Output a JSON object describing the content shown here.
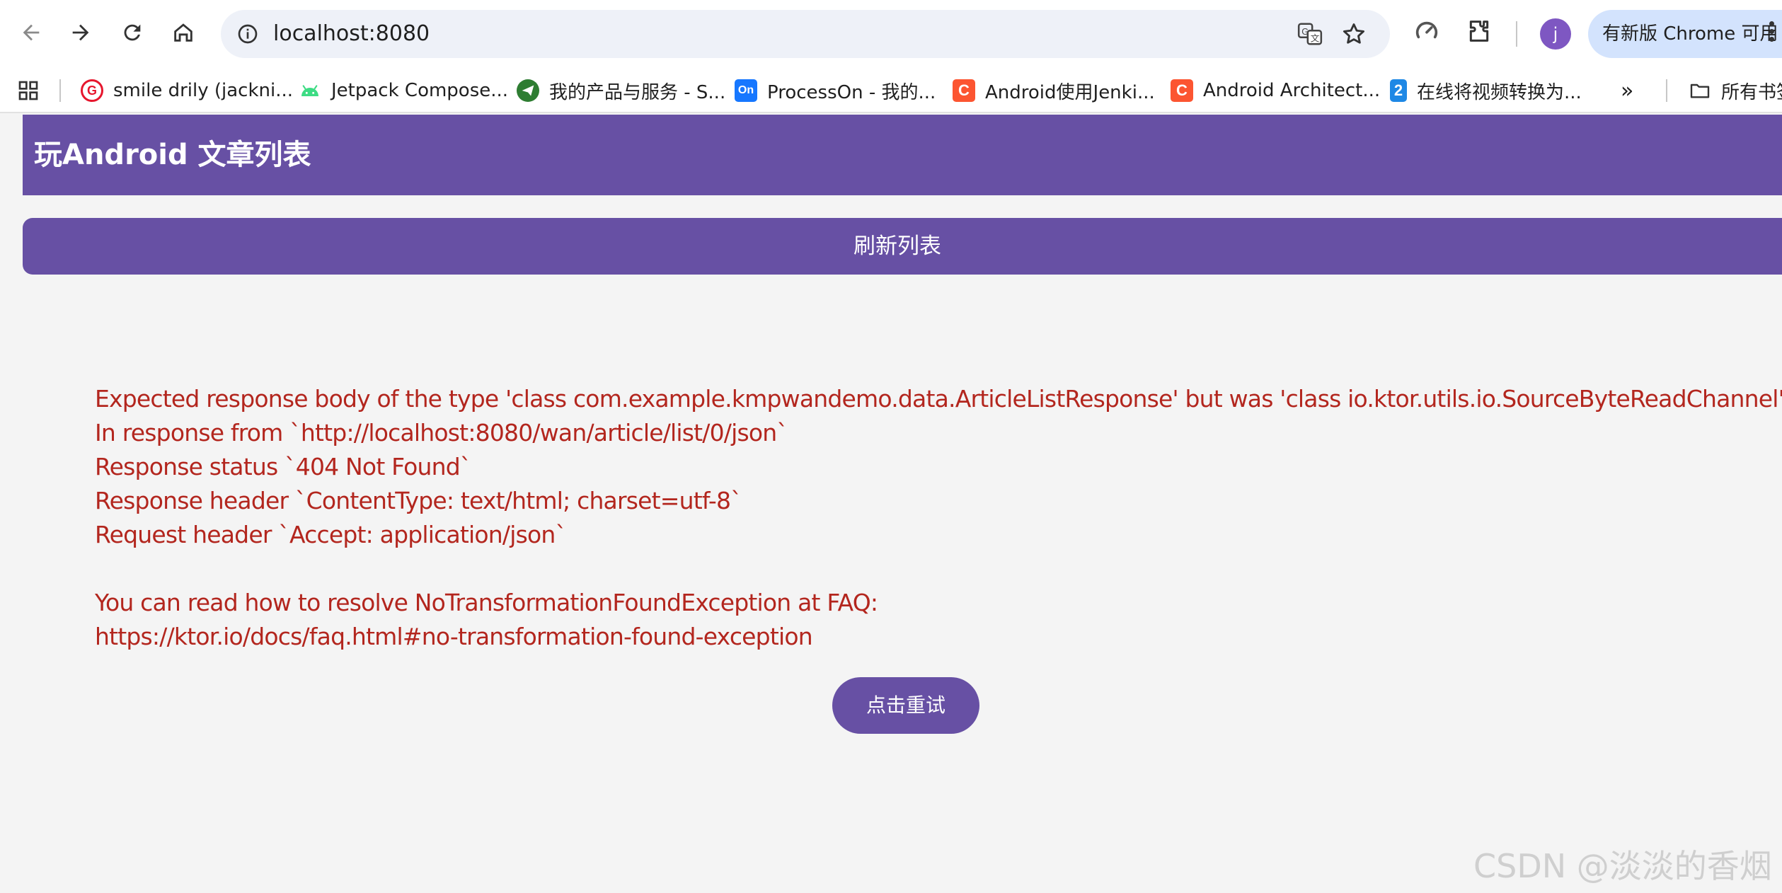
{
  "browser": {
    "url": "localhost:8080",
    "update_label": "有新版 Chrome 可用",
    "profile_initial": "j",
    "bookmarks": [
      {
        "label": "smile drily (jackni...",
        "icon": "weibo-favicon",
        "color": "#e6162d"
      },
      {
        "label": "Jetpack Compose...",
        "icon": "android-favicon",
        "color": "#3ddc84"
      },
      {
        "label": "我的产品与服务 - S...",
        "icon": "paper-plane-favicon",
        "color": "#2e7d32"
      },
      {
        "label": "ProcessOn - 我的...",
        "icon": "processon-favicon",
        "color": "#1677ff",
        "glyph": "On"
      },
      {
        "label": "Android使用Jenki...",
        "icon": "csdn-favicon",
        "color": "#fc5531",
        "glyph": "C"
      },
      {
        "label": "Android Architect...",
        "icon": "csdn-favicon",
        "color": "#fc5531",
        "glyph": "C"
      },
      {
        "label": "在线将视频转换为...",
        "icon": "convert-favicon",
        "color": "#1e88e5",
        "glyph": "2"
      }
    ],
    "all_bookmarks_label": "所有书签"
  },
  "app": {
    "title": "玩Android 文章列表",
    "refresh_label": "刷新列表",
    "retry_label": "点击重试"
  },
  "error": {
    "lines": [
      "Expected response body of the type 'class com.example.kmpwandemo.data.ArticleListResponse' but was 'class io.ktor.utils.io.SourceByteReadChannel'",
      "In response from `http://localhost:8080/wan/article/list/0/json`",
      "Response status `404 Not Found`",
      "Response header `ContentType: text/html; charset=utf-8`",
      "Request header `Accept: application/json`",
      "",
      "You can read how to resolve NoTransformationFoundException at FAQ:",
      "https://ktor.io/docs/faq.html#no-transformation-found-exception"
    ],
    "color": "#b3261e"
  },
  "watermark": "CSDN @淡淡的香烟",
  "colors": {
    "primary": "#6750a4",
    "background": "#f4f4f4"
  }
}
